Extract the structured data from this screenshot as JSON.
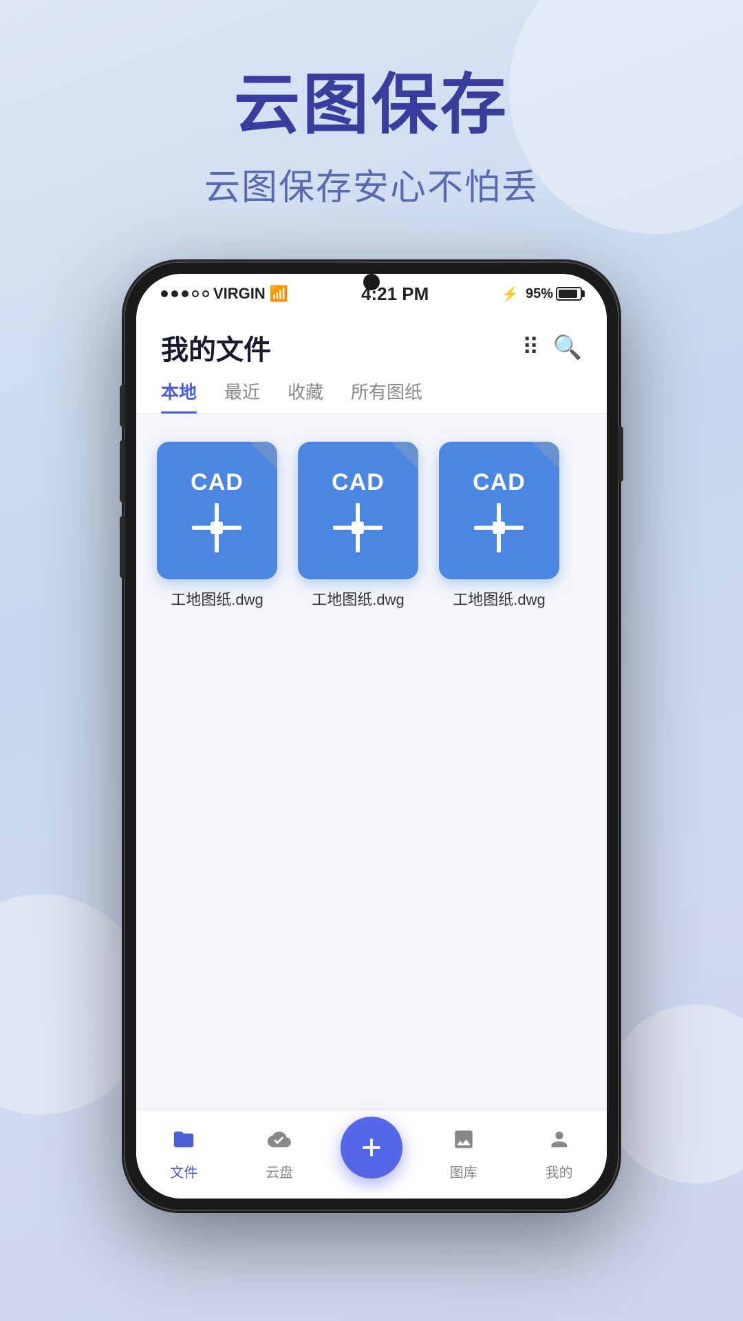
{
  "background": {
    "color": "#d5dff0"
  },
  "hero": {
    "title": "云图保存",
    "subtitle": "云图保存安心不怕丢"
  },
  "status_bar": {
    "carrier": "VIRGIN",
    "time": "4:21 PM",
    "battery_percent": "95%"
  },
  "header": {
    "title": "我的文件"
  },
  "tabs": [
    {
      "label": "本地",
      "active": true
    },
    {
      "label": "最近",
      "active": false
    },
    {
      "label": "收藏",
      "active": false
    },
    {
      "label": "所有图纸",
      "active": false
    }
  ],
  "files": [
    {
      "label": "CAD",
      "name": "工地图纸.dwg"
    },
    {
      "label": "CAD",
      "name": "工地图纸.dwg"
    },
    {
      "label": "CAD",
      "name": "工地图纸.dwg"
    }
  ],
  "bottom_nav": [
    {
      "label": "文件",
      "icon": "📁",
      "active": true
    },
    {
      "label": "云盘",
      "icon": "☁️",
      "active": false
    },
    {
      "label": "",
      "icon": "+",
      "active": false,
      "is_add": true
    },
    {
      "label": "图库",
      "icon": "🖼",
      "active": false
    },
    {
      "label": "我的",
      "icon": "👤",
      "active": false
    }
  ]
}
